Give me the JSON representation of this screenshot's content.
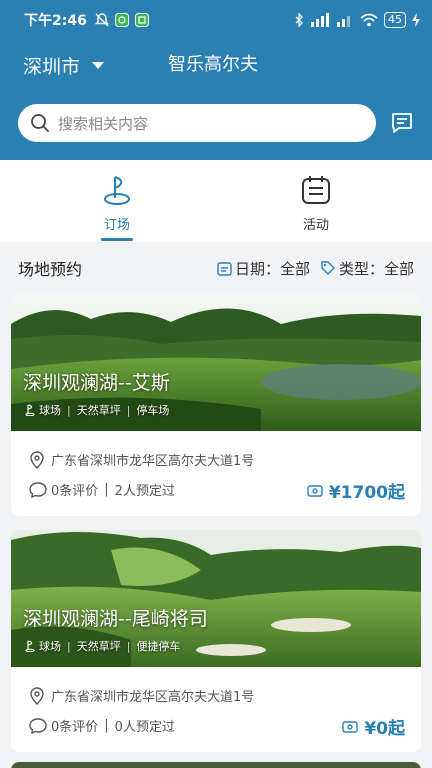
{
  "status_bar": {
    "time": "下午2:46",
    "battery": "45"
  },
  "header": {
    "city": "深圳市",
    "app_title": "智乐高尔夫"
  },
  "search": {
    "placeholder": "搜索相关内容"
  },
  "tabs": [
    {
      "label": "订场",
      "icon": "golf-flag-icon",
      "active": true
    },
    {
      "label": "活动",
      "icon": "calendar-list-icon",
      "active": false
    }
  ],
  "section": {
    "title": "场地预约",
    "date_filter": "日期：全部",
    "type_filter": "类型：全部"
  },
  "courses": [
    {
      "name": "深圳观澜湖--艾斯",
      "tags": [
        "球场",
        "天然草坪",
        "停车场"
      ],
      "address": "广东省深圳市龙华区高尔夫大道1号",
      "reviews": "0条评价",
      "bookings": "2人预定过",
      "price": "¥1700起"
    },
    {
      "name": "深圳观澜湖--尾崎将司",
      "tags": [
        "球场",
        "天然草坪",
        "便捷停车"
      ],
      "address": "广东省深圳市龙华区高尔夫大道1号",
      "reviews": "0条评价",
      "bookings": "0人预定过",
      "price": "¥0起"
    }
  ],
  "colors": {
    "brand": "#2a7fb3",
    "background": "#f2f3f5"
  }
}
